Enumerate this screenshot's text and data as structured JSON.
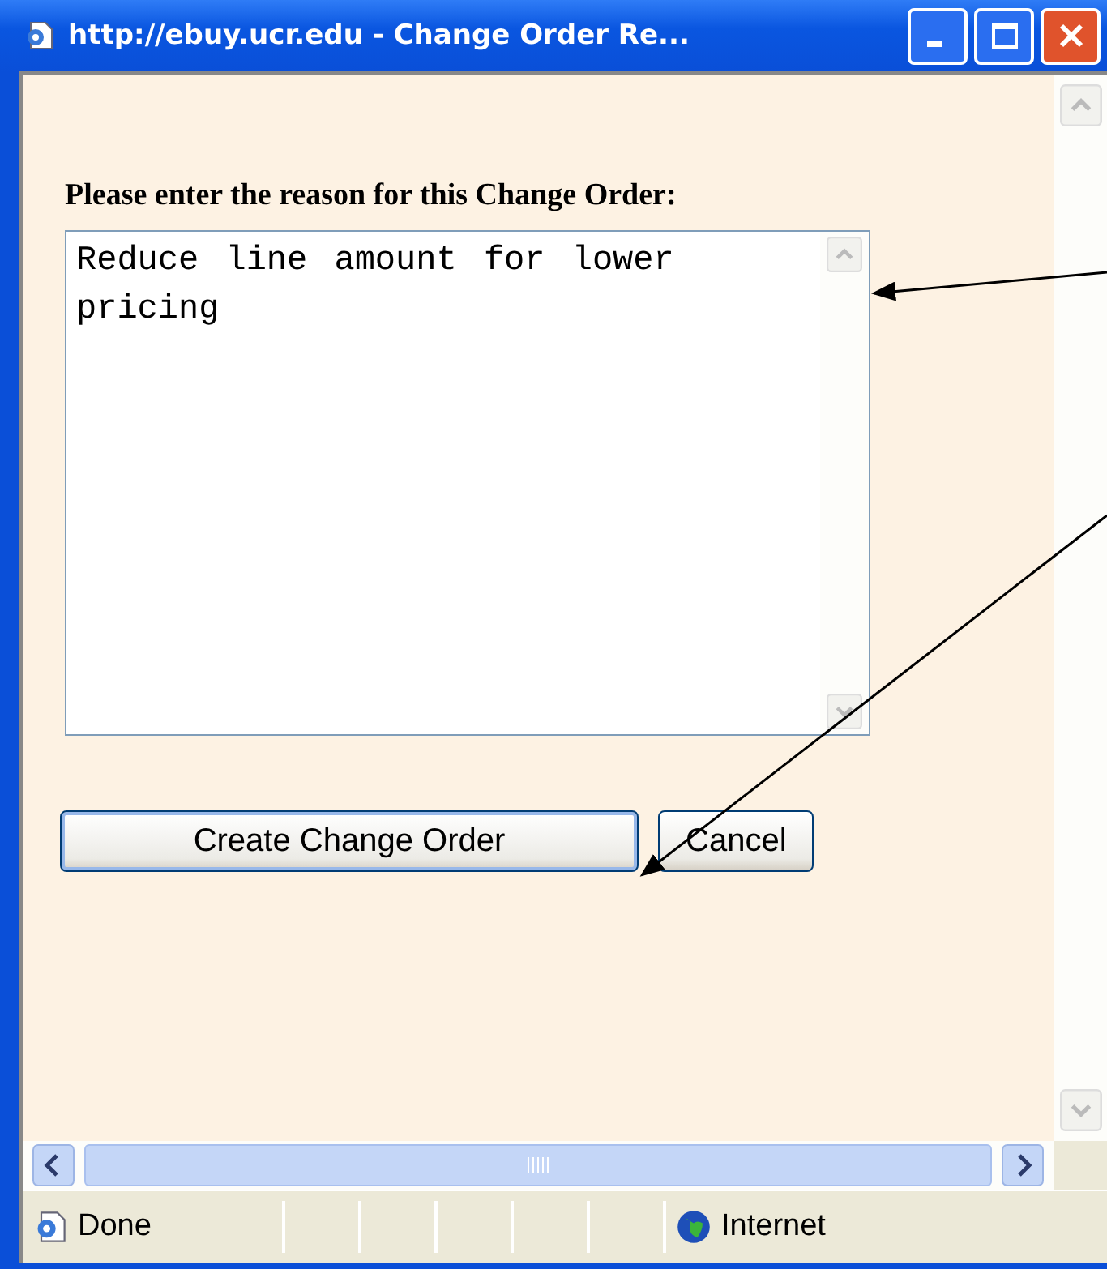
{
  "window": {
    "title": "http://ebuy.ucr.edu - Change Order Re..."
  },
  "form": {
    "label": "Please enter the reason for this Change Order:",
    "reason": "Reduce line amount for lower pricing"
  },
  "buttons": [
    {
      "label": "Create Change Order",
      "focused": true
    },
    {
      "label": "Cancel",
      "focused": false
    }
  ],
  "status_bar": {
    "status": "Done",
    "zone": "Internet"
  }
}
